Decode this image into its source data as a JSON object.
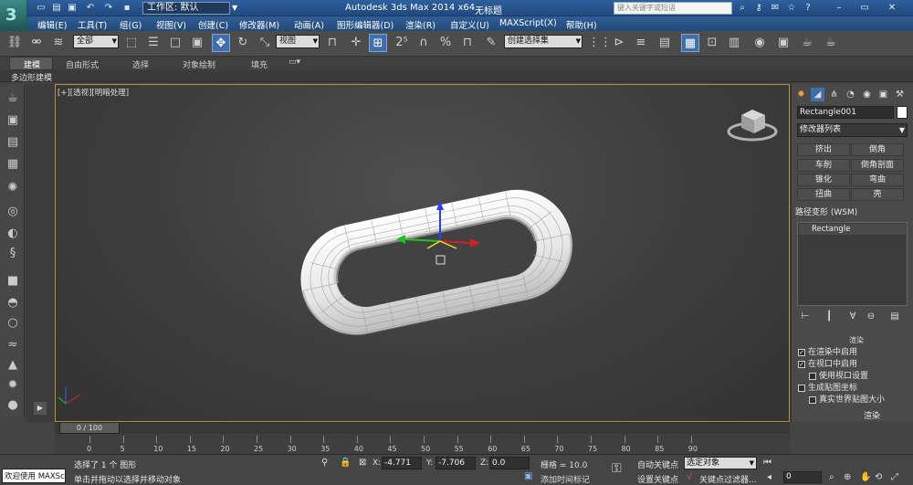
{
  "titlebar": {
    "workspace": "工作区: 默认",
    "app_title": "Autodesk 3ds Max  2014 x64",
    "scene_title": "无标题",
    "search_placeholder": "键入关键字或短语"
  },
  "menu": [
    "编辑(E)",
    "工具(T)",
    "组(G)",
    "视图(V)",
    "创建(C)",
    "修改器(M)",
    "动画(A)",
    "图形编辑器(D)",
    "渲染(R)",
    "自定义(U)",
    "MAXScript(X)",
    "帮助(H)"
  ],
  "toolbar": {
    "selection_filter": "全部",
    "reference_coord": "视图",
    "named_selection": "创建选择集"
  },
  "ribbon": {
    "tabs": [
      "建模",
      "自由形式",
      "选择",
      "对象绘制",
      "填充"
    ],
    "active_tab": "建模",
    "subtab": "多边形建模"
  },
  "viewport": {
    "label": "[+][透视][明暗处理]"
  },
  "command_panel": {
    "object_name": "Rectangle001",
    "object_color": "#ffffff",
    "modifier_list": "修改器列表",
    "modifier_buttons": [
      "挤出",
      "倒角",
      "车削",
      "倒角剖面",
      "锥化",
      "弯曲",
      "扭曲",
      "壳"
    ],
    "wsm_label": "路径变形 (WSM)",
    "stack_item": "Rectangle",
    "rollout_title": "渲染",
    "options": [
      {
        "label": "在渲染中启用",
        "checked": true
      },
      {
        "label": "在视口中启用",
        "checked": true
      },
      {
        "label": "使用视口设置",
        "checked": false
      },
      {
        "label": "生成贴图坐标",
        "checked": false
      },
      {
        "label": "真实世界贴图大小",
        "checked": false
      }
    ],
    "render_label": "渲染"
  },
  "timeline": {
    "slider": "0 / 100",
    "ticks": [
      "0",
      "5",
      "10",
      "15",
      "20",
      "25",
      "30",
      "35",
      "40",
      "45",
      "50",
      "55",
      "60",
      "65",
      "70",
      "75",
      "80",
      "85",
      "90"
    ]
  },
  "statusbar": {
    "welcome": "欢迎使用 MAXSc",
    "status_top": "选择了 1 个 图形",
    "status_bottom": "单击并拖动以选择并移动对象",
    "x_label": "X:",
    "x_value": "-4.771",
    "y_label": "Y:",
    "y_value": "-7.706",
    "z_label": "Z:",
    "z_value": "0.0",
    "grid": "栅格 = 10.0",
    "add_time_tag": "添加时间标记",
    "auto_key": "自动关键点",
    "set_key": "设置关键点",
    "selection_set": "选定对象",
    "key_filters": "关键点过滤器...",
    "frame": "0"
  }
}
